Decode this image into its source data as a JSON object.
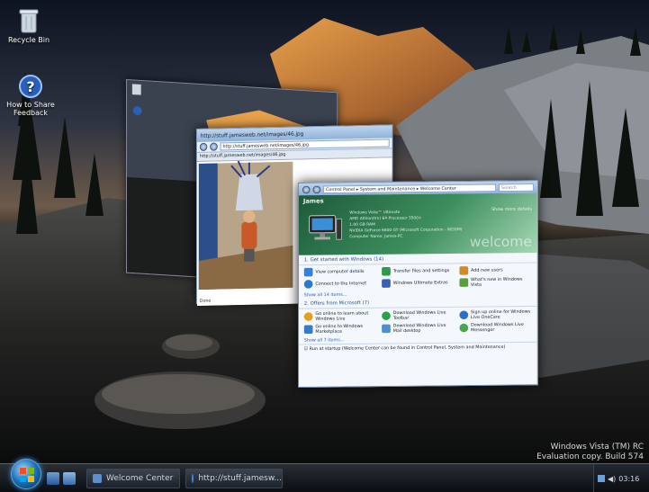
{
  "desktop": {
    "icons": [
      {
        "label": "Recycle Bin",
        "icon": "recycle-bin-icon"
      },
      {
        "label": "How to Share Feedback",
        "icon": "help-icon"
      }
    ],
    "watermark": {
      "line1": "Windows Vista (TM) RC",
      "line2": "Evaluation copy. Build 574"
    }
  },
  "ie_window": {
    "title": "http://stuff.jamesweb.net/images/46.jpg",
    "address": "http://stuff.jamesweb.net/images/46.jpg",
    "tab": "http://stuff.jamesweb.net/images/46.jpg",
    "status": "Done"
  },
  "welcome_center": {
    "breadcrumb": "Control Panel ▸ System and Maintenance ▸ Welcome Center",
    "search_placeholder": "Search",
    "user": "James",
    "specs": [
      "Windows Vista™ Ultimate",
      "AMD Athlon(tm) 64 Processor 3500+",
      "1.00 GB RAM",
      "NVIDIA GeForce 6800 GT (Microsoft Corporation - WDDM)",
      "Computer Name: James-PC"
    ],
    "show_more": "Show more details",
    "welcome_text": "welcome",
    "section1": "1. Get started with Windows (14)",
    "tasks1": [
      {
        "label": "View computer details",
        "icon": "computer-icon",
        "color": "#3a7fd0"
      },
      {
        "label": "Transfer files and settings",
        "icon": "transfer-icon",
        "color": "#2f9a4a"
      },
      {
        "label": "Add new users",
        "icon": "users-icon",
        "color": "#d08a2a"
      },
      {
        "label": "Connect to the Internet",
        "icon": "globe-icon",
        "color": "#2a7ac9"
      },
      {
        "label": "Windows Ultimate Extras",
        "icon": "extras-icon",
        "color": "#3b5fb8"
      },
      {
        "label": "What's new in Windows Vista",
        "icon": "vista-icon",
        "color": "#5a9f3a"
      }
    ],
    "show_all1": "Show all 14 items...",
    "section2": "2. Offers from Microsoft (7)",
    "tasks2": [
      {
        "label": "Go online to learn about Windows Live",
        "icon": "windows-live-icon",
        "color": "#e0a020"
      },
      {
        "label": "Download Windows Live Toolbar",
        "icon": "toolbar-icon",
        "color": "#2aa04a"
      },
      {
        "label": "Sign up online for Windows Live OneCare",
        "icon": "onecare-icon",
        "color": "#2a6fd0"
      },
      {
        "label": "Go online to Windows Marketplace",
        "icon": "marketplace-icon",
        "color": "#3a78c8"
      },
      {
        "label": "Download Windows Live Mail desktop",
        "icon": "mail-icon",
        "color": "#4a90d0"
      },
      {
        "label": "Download Windows Live Messenger",
        "icon": "messenger-icon",
        "color": "#46a84a"
      }
    ],
    "show_all2": "Show all 7 items...",
    "startup_check": "Run at startup (Welcome Center can be found in Control Panel, System and Maintenance)"
  },
  "taskbar": {
    "buttons": [
      {
        "label": "Welcome Center",
        "icon": "welcome-center-icon"
      },
      {
        "label": "http://stuff.jamesw...",
        "icon": "internet-explorer-icon"
      }
    ],
    "clock": "03:16"
  },
  "colors": {
    "accent": "#1b6fb5",
    "banner": "#3d8f5e"
  }
}
